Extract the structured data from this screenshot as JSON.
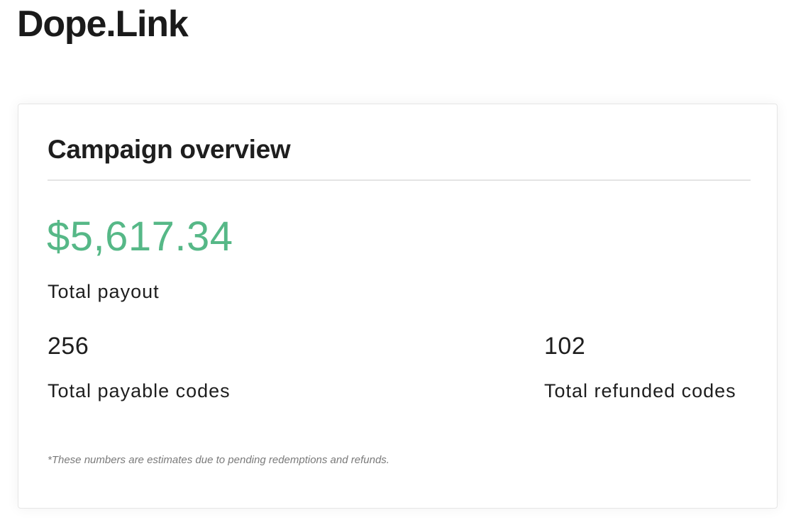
{
  "header": {
    "brand": "Dope.Link"
  },
  "overview": {
    "title": "Campaign overview",
    "total_payout": {
      "value": "$5,617.34",
      "label": "Total payout",
      "color": "#56b887"
    },
    "payable_codes": {
      "value": "256",
      "label": "Total payable codes"
    },
    "refunded_codes": {
      "value": "102",
      "label": "Total refunded codes"
    },
    "footnote": "*These numbers are estimates due to pending redemptions and refunds."
  }
}
